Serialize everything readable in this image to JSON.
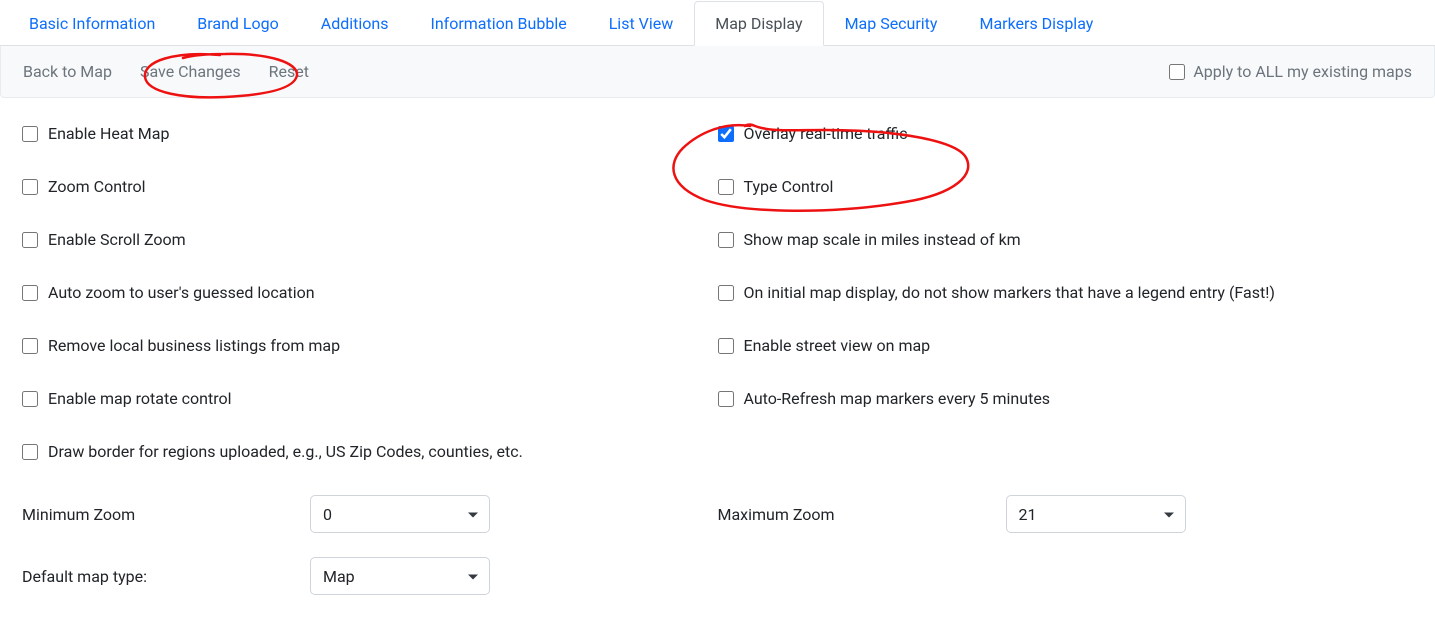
{
  "tabs": [
    {
      "label": "Basic Information"
    },
    {
      "label": "Brand Logo"
    },
    {
      "label": "Additions"
    },
    {
      "label": "Information Bubble"
    },
    {
      "label": "List View"
    },
    {
      "label": "Map Display",
      "active": true
    },
    {
      "label": "Map Security"
    },
    {
      "label": "Markers Display"
    }
  ],
  "actions": {
    "back": "Back to Map",
    "save": "Save Changes",
    "reset": "Reset",
    "apply_all": "Apply to ALL my existing maps"
  },
  "options": {
    "left": [
      {
        "label": "Enable Heat Map",
        "checked": false
      },
      {
        "label": "Zoom Control",
        "checked": false
      },
      {
        "label": "Enable Scroll Zoom",
        "checked": false
      },
      {
        "label": "Auto zoom to user's guessed location",
        "checked": false
      },
      {
        "label": "Remove local business listings from map",
        "checked": false
      },
      {
        "label": "Enable map rotate control",
        "checked": false
      },
      {
        "label": "Draw border for regions uploaded, e.g., US Zip Codes, counties, etc.",
        "checked": false
      }
    ],
    "right": [
      {
        "label": "Overlay real-time traffic",
        "checked": true
      },
      {
        "label": "Type Control",
        "checked": false
      },
      {
        "label": "Show map scale in miles instead of km",
        "checked": false
      },
      {
        "label": "On initial map display, do not show markers that have a legend entry (Fast!)",
        "checked": false
      },
      {
        "label": "Enable street view on map",
        "checked": false
      },
      {
        "label": "Auto-Refresh map markers every 5 minutes",
        "checked": false
      }
    ]
  },
  "selects": {
    "min_zoom": {
      "label": "Minimum Zoom",
      "value": "0"
    },
    "max_zoom": {
      "label": "Maximum Zoom",
      "value": "21"
    },
    "map_type": {
      "label": "Default map type:",
      "value": "Map"
    }
  }
}
